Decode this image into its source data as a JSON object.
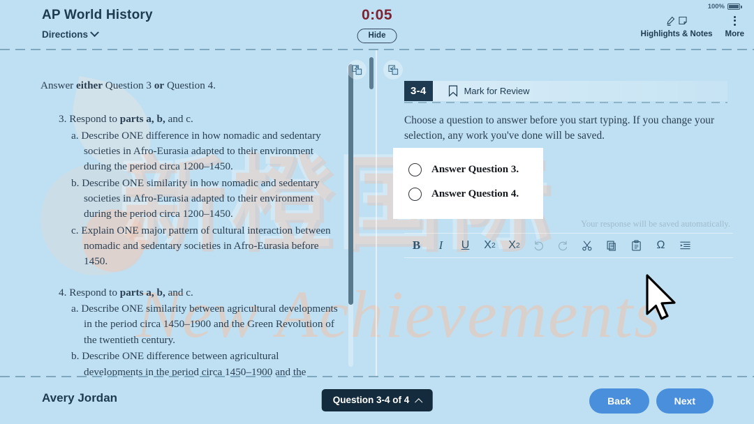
{
  "header": {
    "course_title": "AP World History",
    "directions_label": "Directions",
    "timer": "0:05",
    "hide_label": "Hide",
    "battery_percent": "100%",
    "highlights_label": "Highlights & Notes",
    "more_label": "More"
  },
  "passage": {
    "lead_prefix": "Answer ",
    "lead_either": "either",
    "lead_mid": " Question 3 ",
    "lead_or": "or",
    "lead_suffix": " Question 4.",
    "questions": [
      {
        "number": "3.",
        "stem_prefix": "Respond to ",
        "stem_bold": "parts a, b,",
        "stem_suffix": " and c.",
        "parts": [
          {
            "letter": "a.",
            "text": "Describe ONE difference in how nomadic and sedentary societies in Afro-Eurasia adapted to their environment during the period circa 1200–1450."
          },
          {
            "letter": "b.",
            "text": "Describe ONE similarity in how nomadic and sedentary societies in Afro-Eurasia adapted to their environment during the period circa 1200–1450."
          },
          {
            "letter": "c.",
            "text": "Explain ONE major pattern of cultural interaction between nomadic and sedentary societies in Afro-Eurasia before 1450."
          }
        ]
      },
      {
        "number": "4.",
        "stem_prefix": "Respond to ",
        "stem_bold": "parts a, b,",
        "stem_suffix": " and c.",
        "parts": [
          {
            "letter": "a.",
            "text": "Describe ONE similarity between agricultural developments in the period circa 1450–1900 and the Green Revolution of the twentieth century."
          },
          {
            "letter": "b.",
            "text": "Describe ONE difference between agricultural developments in the period circa 1450–1900 and the"
          }
        ]
      }
    ]
  },
  "question_panel": {
    "badge": "3-4",
    "mark_for_review": "Mark for Review",
    "prompt": "Choose a question to answer before you start typing. If you change your selection, any work you've done will be saved.",
    "options": [
      {
        "label": "Answer Question 3.",
        "selected": false
      },
      {
        "label": "Answer Question 4.",
        "selected": false
      }
    ],
    "autosave_note": "Your response will be saved automatically.",
    "toolbar": [
      {
        "name": "bold",
        "glyph": "B"
      },
      {
        "name": "italic",
        "glyph": "I"
      },
      {
        "name": "underline",
        "glyph": "U"
      },
      {
        "name": "superscript",
        "glyph": "X²"
      },
      {
        "name": "subscript",
        "glyph": "X₂"
      },
      {
        "name": "undo",
        "glyph": "↺"
      },
      {
        "name": "redo",
        "glyph": "↻"
      },
      {
        "name": "cut",
        "glyph": "✂"
      },
      {
        "name": "copy",
        "glyph": "⧉"
      },
      {
        "name": "paste",
        "glyph": "Ὄb"
      },
      {
        "name": "special-character",
        "glyph": "Ω"
      },
      {
        "name": "indent",
        "glyph": "≡"
      }
    ]
  },
  "footer": {
    "student_name": "Avery Jordan",
    "question_nav": "Question 3-4 of 4",
    "back_label": "Back",
    "next_label": "Next"
  },
  "watermark": {
    "cjk_text": "新橙国际",
    "latin_text": "New Achievements"
  },
  "colors": {
    "background": "#bfe0f2",
    "timer": "#7c2233",
    "badge": "#1d3a50",
    "accent_button": "#4a8fdc",
    "nav_pill": "#132b3d"
  }
}
